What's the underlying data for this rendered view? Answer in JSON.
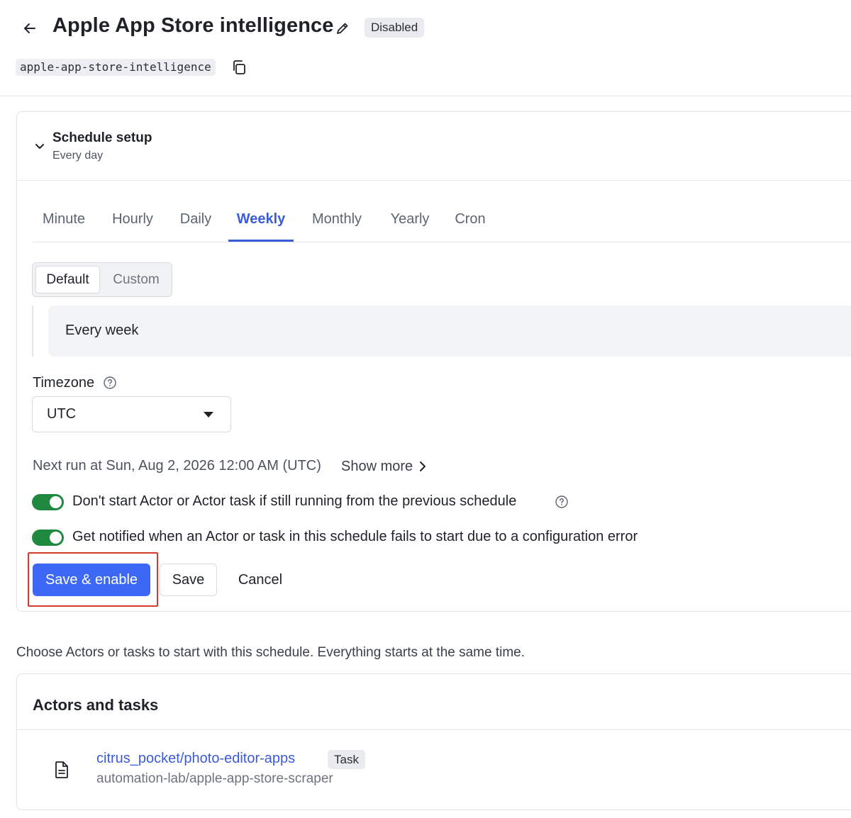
{
  "header": {
    "title": "Apple App Store intelligence",
    "status": "Disabled",
    "slug": "apple-app-store-intelligence",
    "icons": {
      "back": "arrow-left-icon",
      "edit": "pencil-icon",
      "copy": "copy-icon"
    }
  },
  "schedule": {
    "title": "Schedule setup",
    "subtitle": "Every day",
    "tabs": [
      {
        "label": "Minute",
        "active": false
      },
      {
        "label": "Hourly",
        "active": false
      },
      {
        "label": "Daily",
        "active": false
      },
      {
        "label": "Weekly",
        "active": true
      },
      {
        "label": "Monthly",
        "active": false
      },
      {
        "label": "Yearly",
        "active": false
      },
      {
        "label": "Cron",
        "active": false
      }
    ],
    "mode_default": "Default",
    "mode_custom": "Custom",
    "selected_mode": "Default",
    "frequency": "Every week",
    "timezone_label": "Timezone",
    "timezone_value": "UTC",
    "next_run": "Next run at Sun, Aug 2, 2026 12:00 AM (UTC)",
    "show_more": "Show more",
    "toggle_skip_label": "Don't start Actor or Actor task if still running from the previous schedule",
    "toggle_skip_on": true,
    "toggle_notify_label": "Get notified when an Actor or task in this schedule fails to start due to a configuration error",
    "toggle_notify_on": true,
    "save_enable": "Save & enable",
    "save": "Save",
    "cancel": "Cancel"
  },
  "actors": {
    "intro": "Choose Actors or tasks to start with this schedule. Everything starts at the same time.",
    "title": "Actors and tasks",
    "items": [
      {
        "name": "citrus_pocket/photo-editor-apps",
        "badge": "Task",
        "source": "automation-lab/apple-app-store-scraper"
      }
    ]
  },
  "colors": {
    "accent": "#3b5bd9",
    "primary_button": "#3d68f5",
    "toggle_on": "#1f8a3f",
    "highlight_outline": "#d9392b"
  }
}
